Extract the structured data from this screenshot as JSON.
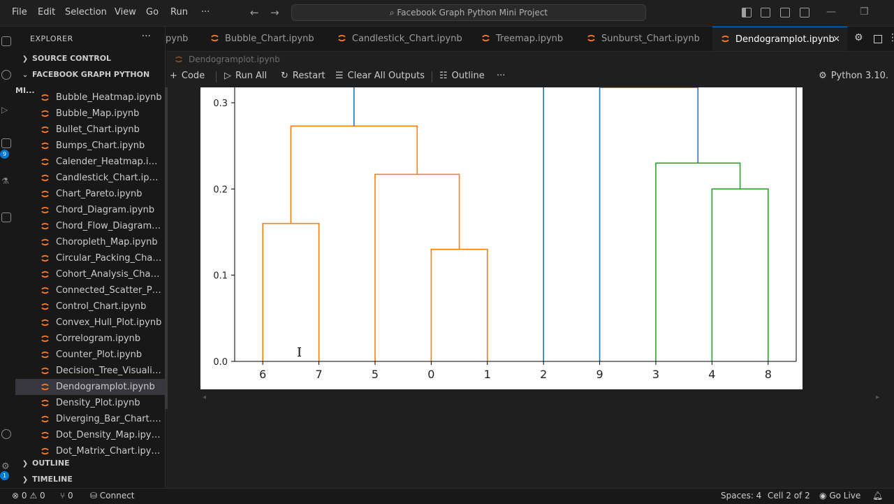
{
  "menu": [
    "File",
    "Edit",
    "Selection",
    "View",
    "Go",
    "Run"
  ],
  "menu_more": "···",
  "command_center": "Facebook Graph Python Mini Project",
  "activity_badges": [
    "9",
    "1"
  ],
  "sidebar": {
    "title": "EXPLORER",
    "more": "···",
    "source_control": "SOURCE CONTROL",
    "project": "FACEBOOK GRAPH PYTHON MI...",
    "files": [
      "Bubble_Heatmap.ipynb",
      "Bubble_Map.ipynb",
      "Bullet_Chart.ipynb",
      "Bumps_Chart.ipynb",
      "Calender_Heatmap.ipynb",
      "Candlestick_Chart.ipynb",
      "Chart_Pareto.ipynb",
      "Chord_Diagram.ipynb",
      "Chord_Flow_Diagram.ip...",
      "Choropleth_Map.ipynb",
      "Circular_Packing_Chart.i...",
      "Cohort_Analysis_Chart.i...",
      "Connected_Scatter_Plot...",
      "Control_Chart.ipynb",
      "Convex_Hull_Plot.ipynb",
      "Correlogram.ipynb",
      "Counter_Plot.ipynb",
      "Decision_Tree_Visualisa...",
      "Dendogramplot.ipynb",
      "Density_Plot.ipynb",
      "Diverging_Bar_Chart.ip...",
      "Dot_Density_Map.ipynb",
      "Dot_Matrix_Chart.ipynb"
    ],
    "selected_file": "Dendogramplot.ipynb",
    "outline": "OUTLINE",
    "timeline": "TIMELINE"
  },
  "tabs": [
    {
      "label": "pynb",
      "active": false
    },
    {
      "label": "Bubble_Chart.ipynb",
      "active": false
    },
    {
      "label": "Candlestick_Chart.ipynb",
      "active": false
    },
    {
      "label": "Treemap.ipynb",
      "active": false
    },
    {
      "label": "Sunburst_Chart.ipynb",
      "active": false
    },
    {
      "label": "Dendogramplot.ipynb",
      "active": true
    }
  ],
  "tab_close": "✕",
  "breadcrumb": "Dendogramplot.ipynb",
  "notebook_toolbar": {
    "code": "Code",
    "run_all": "Run All",
    "restart": "Restart",
    "clear": "Clear All Outputs",
    "outline": "Outline",
    "more": "···",
    "kernel": "Python 3.10."
  },
  "status": {
    "errors": "0",
    "warnings": "0",
    "ports": "0",
    "connect": "Connect",
    "spaces": "Spaces: 4",
    "cell": "Cell 2 of 2",
    "go_live": "Go Live"
  },
  "colors": {
    "orange": "#ff7f0e",
    "green": "#2ca02c",
    "blue": "#1f77b4",
    "accent": "#0078d4"
  },
  "chart_data": {
    "type": "dendrogram",
    "leaf_labels": [
      "6",
      "7",
      "5",
      "0",
      "1",
      "2",
      "9",
      "3",
      "4",
      "8"
    ],
    "ylim": [
      0,
      0.32
    ],
    "yticks": [
      "0.0",
      "0.1",
      "0.2",
      "0.3"
    ],
    "merges": [
      {
        "left": "0",
        "right": "1",
        "height": 0.13,
        "color": "orange"
      },
      {
        "left": "6",
        "right": "7",
        "height": 0.16,
        "color": "orange"
      },
      {
        "left": "4",
        "right": "8",
        "height": 0.2,
        "color": "green"
      },
      {
        "left": "5",
        "right": "(0,1)",
        "height": 0.217,
        "color": "orange"
      },
      {
        "left": "3",
        "right": "(4,8)",
        "height": 0.23,
        "color": "green"
      },
      {
        "left": "(6,7)",
        "right": "(5,0,1)",
        "height": 0.273,
        "color": "orange"
      }
    ],
    "above_view_links": [
      "(6,7,5,0,1)",
      "2",
      "9",
      "(3,4,8)"
    ]
  }
}
